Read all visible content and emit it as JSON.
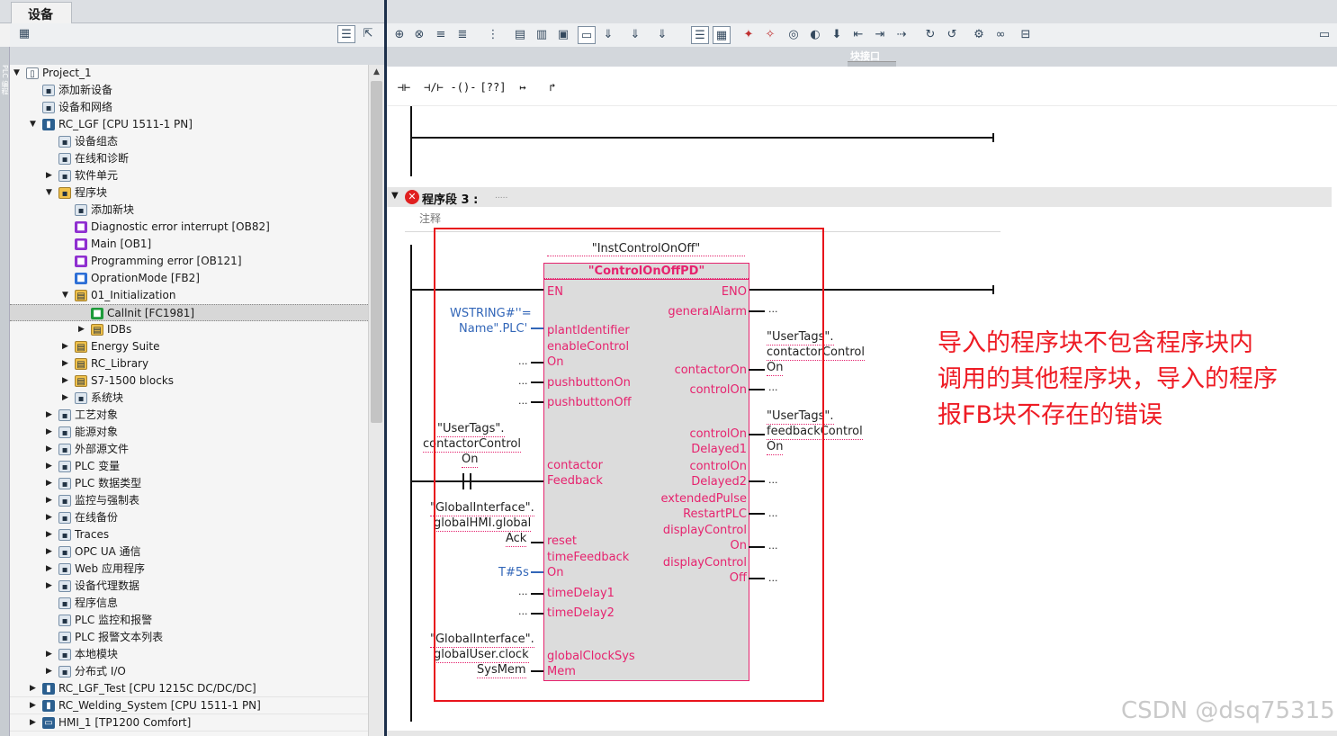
{
  "left_panel": {
    "tab_label": "设备",
    "side_strip_label": "PLC 编程",
    "tree": [
      {
        "label": "Project_1",
        "depth": 0,
        "expanded": true,
        "icon": "project-icon"
      },
      {
        "label": "添加新设备",
        "depth": 1,
        "icon": "add-device-icon"
      },
      {
        "label": "设备和网络",
        "depth": 1,
        "icon": "network-icon"
      },
      {
        "label": "RC_LGF [CPU 1511-1 PN]",
        "depth": 1,
        "expanded": true,
        "icon": "plc-icon"
      },
      {
        "label": "设备组态",
        "depth": 2,
        "icon": "device-config-icon"
      },
      {
        "label": "在线和诊断",
        "depth": 2,
        "icon": "diagnostics-icon"
      },
      {
        "label": "软件单元",
        "depth": 2,
        "collapsed": true,
        "icon": "software-unit-icon"
      },
      {
        "label": "程序块",
        "depth": 2,
        "expanded": true,
        "icon": "program-blocks-icon"
      },
      {
        "label": "添加新块",
        "depth": 3,
        "icon": "add-block-icon"
      },
      {
        "label": "Diagnostic error interrupt [OB82]",
        "depth": 3,
        "icon": "ob-icon"
      },
      {
        "label": "Main [OB1]",
        "depth": 3,
        "icon": "ob-icon"
      },
      {
        "label": "Programming error [OB121]",
        "depth": 3,
        "icon": "ob-icon"
      },
      {
        "label": "OprationMode [FB2]",
        "depth": 3,
        "icon": "fb-icon"
      },
      {
        "label": "01_Initialization",
        "depth": 3,
        "expanded": true,
        "icon": "folder-icon"
      },
      {
        "label": "Callnit [FC1981]",
        "depth": 4,
        "icon": "fc-icon",
        "selected": true
      },
      {
        "label": "IDBs",
        "depth": 4,
        "collapsed": true,
        "icon": "folder-icon"
      },
      {
        "label": "Energy Suite",
        "depth": 3,
        "collapsed": true,
        "icon": "folder-icon"
      },
      {
        "label": "RC_Library",
        "depth": 3,
        "collapsed": true,
        "icon": "folder-icon"
      },
      {
        "label": "S7-1500 blocks",
        "depth": 3,
        "collapsed": true,
        "icon": "folder-icon"
      },
      {
        "label": "系统块",
        "depth": 3,
        "collapsed": true,
        "icon": "system-blocks-icon"
      },
      {
        "label": "工艺对象",
        "depth": 2,
        "collapsed": true,
        "icon": "technology-icon"
      },
      {
        "label": "能源对象",
        "depth": 2,
        "collapsed": true,
        "icon": "energy-icon"
      },
      {
        "label": "外部源文件",
        "depth": 2,
        "collapsed": true,
        "icon": "source-file-icon"
      },
      {
        "label": "PLC 变量",
        "depth": 2,
        "collapsed": true,
        "icon": "plc-tags-icon"
      },
      {
        "label": "PLC 数据类型",
        "depth": 2,
        "collapsed": true,
        "icon": "data-types-icon"
      },
      {
        "label": "监控与强制表",
        "depth": 2,
        "collapsed": true,
        "icon": "watch-table-icon"
      },
      {
        "label": "在线备份",
        "depth": 2,
        "collapsed": true,
        "icon": "backup-icon"
      },
      {
        "label": "Traces",
        "depth": 2,
        "collapsed": true,
        "icon": "traces-icon"
      },
      {
        "label": "OPC UA 通信",
        "depth": 2,
        "collapsed": true,
        "icon": "opc-ua-icon"
      },
      {
        "label": "Web 应用程序",
        "depth": 2,
        "collapsed": true,
        "icon": "web-app-icon"
      },
      {
        "label": "设备代理数据",
        "depth": 2,
        "collapsed": true,
        "icon": "proxy-data-icon"
      },
      {
        "label": "程序信息",
        "depth": 2,
        "icon": "program-info-icon"
      },
      {
        "label": "PLC 监控和报警",
        "depth": 2,
        "icon": "alarm-icon"
      },
      {
        "label": "PLC 报警文本列表",
        "depth": 2,
        "icon": "alarm-text-icon"
      },
      {
        "label": "本地模块",
        "depth": 2,
        "collapsed": true,
        "icon": "local-module-icon"
      },
      {
        "label": "分布式 I/O",
        "depth": 2,
        "collapsed": true,
        "icon": "distributed-io-icon"
      },
      {
        "label": "RC_LGF_Test [CPU 1215C DC/DC/DC]",
        "depth": 1,
        "collapsed": true,
        "icon": "plc-icon"
      },
      {
        "label": "RC_Welding_System [CPU 1511-1 PN]",
        "depth": 1,
        "collapsed": true,
        "icon": "plc-icon"
      },
      {
        "label": "HMI_1 [TP1200 Comfort]",
        "depth": 1,
        "collapsed": true,
        "icon": "hmi-icon"
      }
    ]
  },
  "editor": {
    "interface_label": "块接口",
    "ladder_buttons": [
      {
        "name": "no-contact-button",
        "glyph": "⊣⊢"
      },
      {
        "name": "nc-contact-button",
        "glyph": "⊣/⊢"
      },
      {
        "name": "coil-button",
        "glyph": "-()-"
      },
      {
        "name": "empty-box-button",
        "glyph": "[??]"
      },
      {
        "name": "open-branch-button",
        "glyph": "↦"
      },
      {
        "name": "close-branch-button",
        "glyph": "↱"
      }
    ],
    "network": {
      "title": "程序段 3 :",
      "title_dots": ".....",
      "comment": "注释",
      "instance": "\"InstControlOnOff\"",
      "block_type": "\"ControlOnOffPD\"",
      "inputs": [
        "EN",
        "plantIdentifier",
        "enableControl",
        "On",
        "pushbuttonOn",
        "pushbuttonOff",
        "contactor",
        "Feedback",
        "reset",
        "timeFeedback",
        "On",
        "timeDelay1",
        "timeDelay2",
        "globalClockSys",
        "Mem"
      ],
      "outputs": [
        "ENO",
        "generalAlarm",
        "contactorOn",
        "controlOn",
        "controlOn",
        "Delayed1",
        "controlOn",
        "Delayed2",
        "extendedPulse",
        "RestartPLC",
        "displayControl",
        "On",
        "displayControl",
        "Off"
      ],
      "input_params": {
        "plant_id_1": "WSTRING#''=",
        "plant_id_2": "Name\".PLC'",
        "contactor_1": "\"UserTags\".",
        "contactor_2": "contactorControl",
        "contactor_3": "On",
        "reset_1": "\"GlobalInterface\".",
        "reset_2": "globalHMI.global",
        "reset_3": "Ack",
        "time_feedback": "T#5s",
        "clock_1": "\"GlobalInterface\".",
        "clock_2": "globalUser.clock",
        "clock_3": "SysMem",
        "placeholder": "..."
      },
      "output_params": {
        "contactor_on_1": "\"UserTags\".",
        "contactor_on_2": "contactorControl",
        "contactor_on_3": "On",
        "feedback_1": "\"UserTags\".",
        "feedback_2": "feedbackControl",
        "feedback_3": "On",
        "placeholder": "..."
      }
    }
  },
  "annotation": {
    "lines": [
      "导入的程序块不包含程序块内",
      "调用的其他程序块，导入的程序",
      "报FB块不存在的错误"
    ],
    "color": "#ee1b24"
  },
  "watermark": "CSDN @dsq75315",
  "colors": {
    "pin_red": "#e6236e",
    "param_blue": "#3266b8",
    "error_box": "#e8141c",
    "splitter": "#1c2f4a"
  }
}
